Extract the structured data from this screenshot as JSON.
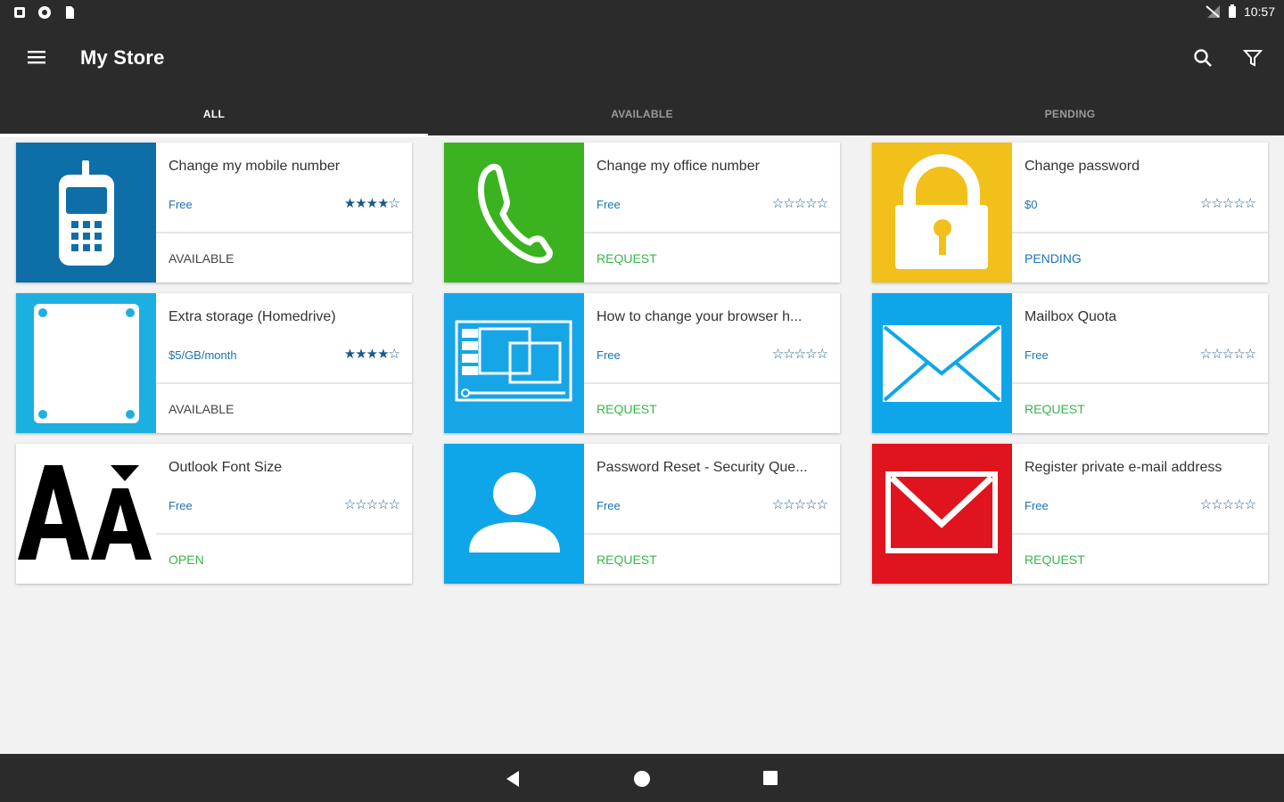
{
  "status_bar": {
    "time": "10:57",
    "left_icons": [
      "notification-icon",
      "sync-icon",
      "sd-card-icon"
    ],
    "right_icons": [
      "no-signal-icon",
      "battery-icon"
    ]
  },
  "app_bar": {
    "title": "My Store",
    "icons": [
      "menu-icon",
      "search-icon",
      "filter-icon"
    ]
  },
  "tabs": [
    {
      "label": "ALL",
      "active": true
    },
    {
      "label": "AVAILABLE",
      "active": false
    },
    {
      "label": "PENDING",
      "active": false
    }
  ],
  "cards": [
    {
      "title": "Change my mobile number",
      "price": "Free",
      "stars": "★★★★☆",
      "status": "AVAILABLE",
      "icon": "mobile-phone-icon",
      "color": "#0e6ea8"
    },
    {
      "title": "Change my office number",
      "price": "Free",
      "stars": "☆☆☆☆☆",
      "status": "REQUEST",
      "icon": "phone-handset-icon",
      "color": "#3bb21f"
    },
    {
      "title": "Change password",
      "price": "$0",
      "stars": "☆☆☆☆☆",
      "status": "PENDING",
      "icon": "padlock-icon",
      "color": "#f2c01b"
    },
    {
      "title": "Extra storage (Homedrive)",
      "price": "$5/GB/month",
      "stars": "★★★★☆",
      "status": "AVAILABLE",
      "icon": "hard-drive-icon",
      "color": "#1cb0e0"
    },
    {
      "title": "How to change your browser h...",
      "price": "Free",
      "stars": "☆☆☆☆☆",
      "status": "REQUEST",
      "icon": "browser-window-icon",
      "color": "#16a6e8"
    },
    {
      "title": "Mailbox Quota",
      "price": "Free",
      "stars": "☆☆☆☆☆",
      "status": "REQUEST",
      "icon": "envelope-icon",
      "color": "#0ea6e8"
    },
    {
      "title": "Outlook Font Size",
      "price": "Free",
      "stars": "☆☆☆☆☆",
      "status": "OPEN",
      "icon": "font-size-icon",
      "color": "#ffffff"
    },
    {
      "title": "Password Reset - Security Que...",
      "price": "Free",
      "stars": "☆☆☆☆☆",
      "status": "REQUEST",
      "icon": "user-avatar-icon",
      "color": "#0ea6e8"
    },
    {
      "title": "Register private e-mail address",
      "price": "Free",
      "stars": "☆☆☆☆☆",
      "status": "REQUEST",
      "icon": "mail-red-icon",
      "color": "#e0141e"
    }
  ],
  "nav_bar": {
    "icons": [
      "back-icon",
      "home-icon",
      "recents-icon"
    ]
  }
}
